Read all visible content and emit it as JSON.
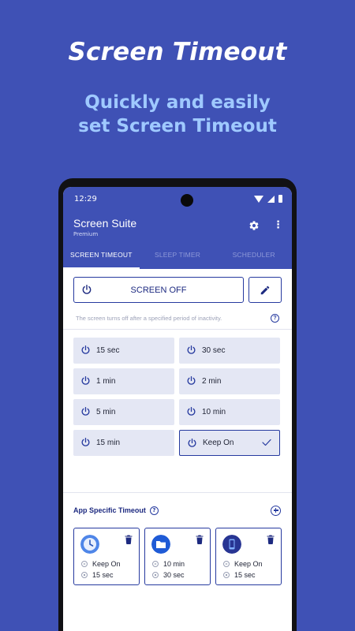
{
  "promo": {
    "title": "Screen Timeout",
    "subtitle_line1": "Quickly and easily",
    "subtitle_line2": "set Screen Timeout"
  },
  "status_bar": {
    "time": "12:29",
    "icons": [
      "wifi-icon",
      "signal-icon",
      "battery-icon"
    ]
  },
  "app_bar": {
    "title": "Screen Suite",
    "tier": "Premium",
    "actions": [
      "settings-gear-icon",
      "more-vert-icon"
    ]
  },
  "tabs": [
    {
      "label": "SCREEN TIMEOUT",
      "active": true
    },
    {
      "label": "SLEEP TIMER",
      "active": false
    },
    {
      "label": "SCHEDULER",
      "active": false
    }
  ],
  "screen_off": {
    "label": "SCREEN OFF",
    "icon": "power-icon",
    "edit_icon": "pencil-icon"
  },
  "hint": {
    "text": "The screen turns off after a specified period of inactivity.",
    "help_glyph": "?"
  },
  "timeouts": [
    {
      "label": "15 sec",
      "selected": false
    },
    {
      "label": "30 sec",
      "selected": false
    },
    {
      "label": "1 min",
      "selected": false
    },
    {
      "label": "2 min",
      "selected": false
    },
    {
      "label": "5 min",
      "selected": false
    },
    {
      "label": "10 min",
      "selected": false
    },
    {
      "label": "15 min",
      "selected": false
    },
    {
      "label": "Keep On",
      "selected": true
    }
  ],
  "app_specific": {
    "title": "App Specific Timeout",
    "help_glyph": "?",
    "cards": [
      {
        "app_icon": "clock-app-icon",
        "on_value": "Keep On",
        "off_value": "15 sec"
      },
      {
        "app_icon": "files-app-icon",
        "on_value": "10 min",
        "off_value": "30 sec"
      },
      {
        "app_icon": "phone-app-icon",
        "on_value": "Keep On",
        "off_value": "15 sec"
      }
    ]
  },
  "colors": {
    "background": "#3f51b5",
    "accent": "#263a9f",
    "subtitle": "#9fc9ff",
    "option_fill": "#e4e7f4"
  }
}
